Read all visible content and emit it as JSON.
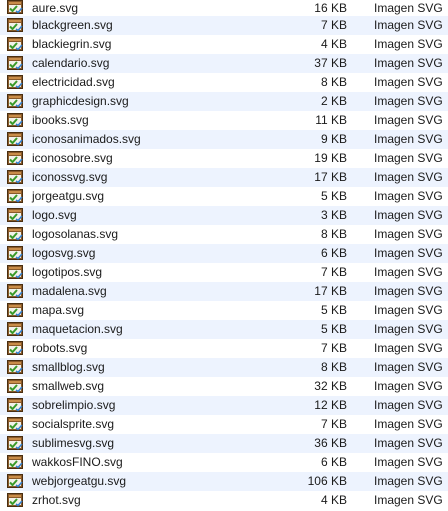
{
  "file_icon": "svg-document-icon",
  "rows": [
    {
      "name": "aure.svg",
      "size": "16 KB",
      "kind": "Imagen SVG"
    },
    {
      "name": "blackgreen.svg",
      "size": "7 KB",
      "kind": "Imagen SVG"
    },
    {
      "name": "blackiegrin.svg",
      "size": "4 KB",
      "kind": "Imagen SVG"
    },
    {
      "name": "calendario.svg",
      "size": "37 KB",
      "kind": "Imagen SVG"
    },
    {
      "name": "electricidad.svg",
      "size": "8 KB",
      "kind": "Imagen SVG"
    },
    {
      "name": "graphicdesign.svg",
      "size": "2 KB",
      "kind": "Imagen SVG"
    },
    {
      "name": "ibooks.svg",
      "size": "11 KB",
      "kind": "Imagen SVG"
    },
    {
      "name": "iconosanimados.svg",
      "size": "9 KB",
      "kind": "Imagen SVG"
    },
    {
      "name": "iconosobre.svg",
      "size": "19 KB",
      "kind": "Imagen SVG"
    },
    {
      "name": "iconossvg.svg",
      "size": "17 KB",
      "kind": "Imagen SVG"
    },
    {
      "name": "jorgeatgu.svg",
      "size": "5 KB",
      "kind": "Imagen SVG"
    },
    {
      "name": "logo.svg",
      "size": "3 KB",
      "kind": "Imagen SVG"
    },
    {
      "name": "logosolanas.svg",
      "size": "8 KB",
      "kind": "Imagen SVG"
    },
    {
      "name": "logosvg.svg",
      "size": "6 KB",
      "kind": "Imagen SVG"
    },
    {
      "name": "logotipos.svg",
      "size": "7 KB",
      "kind": "Imagen SVG"
    },
    {
      "name": "madalena.svg",
      "size": "17 KB",
      "kind": "Imagen SVG"
    },
    {
      "name": "mapa.svg",
      "size": "5 KB",
      "kind": "Imagen SVG"
    },
    {
      "name": "maquetacion.svg",
      "size": "5 KB",
      "kind": "Imagen SVG"
    },
    {
      "name": "robots.svg",
      "size": "7 KB",
      "kind": "Imagen SVG"
    },
    {
      "name": "smallblog.svg",
      "size": "8 KB",
      "kind": "Imagen SVG"
    },
    {
      "name": "smallweb.svg",
      "size": "32 KB",
      "kind": "Imagen SVG"
    },
    {
      "name": "sobrelimpio.svg",
      "size": "12 KB",
      "kind": "Imagen SVG"
    },
    {
      "name": "socialsprite.svg",
      "size": "7 KB",
      "kind": "Imagen SVG"
    },
    {
      "name": "sublimesvg.svg",
      "size": "36 KB",
      "kind": "Imagen SVG"
    },
    {
      "name": "wakkosFINO.svg",
      "size": "6 KB",
      "kind": "Imagen SVG"
    },
    {
      "name": "webjorgeatgu.svg",
      "size": "106 KB",
      "kind": "Imagen SVG"
    },
    {
      "name": "zrhot.svg",
      "size": "4 KB",
      "kind": "Imagen SVG"
    }
  ]
}
